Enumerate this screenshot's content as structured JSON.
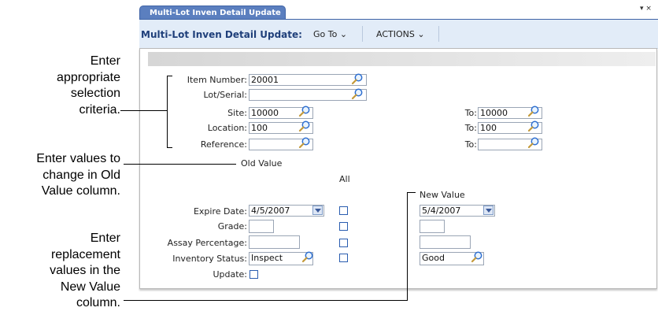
{
  "tab": {
    "title": "Multi-Lot Inven Detail Update",
    "menu": "▾ ×"
  },
  "toolbar": {
    "title": "Multi-Lot Inven Detail Update:",
    "goto": "Go To ⌄",
    "actions": "ACTIONS ⌄"
  },
  "callouts": {
    "selection": [
      "Enter",
      "appropriate",
      "selection",
      "criteria."
    ],
    "old_value": [
      "Enter values to",
      "change in Old",
      "Value column."
    ],
    "replacement": [
      "Enter",
      "replacement",
      "values in the",
      "New Value",
      "column."
    ]
  },
  "form": {
    "item_number": {
      "label": "Item Number:",
      "value": "20001"
    },
    "lot_serial": {
      "label": "Lot/Serial:",
      "value": ""
    },
    "site": {
      "label": "Site:",
      "value": "10000",
      "to_label": "To:",
      "to_value": "10000"
    },
    "location": {
      "label": "Location:",
      "value": "100",
      "to_label": "To:",
      "to_value": "100"
    },
    "reference": {
      "label": "Reference:",
      "value": "",
      "to_label": "To:",
      "to_value": ""
    },
    "old_value_header": "Old Value",
    "all_header": "All",
    "new_value_header": "New Value",
    "expire_date": {
      "label": "Expire Date:",
      "old": "4/5/2007",
      "new": "5/4/2007"
    },
    "grade": {
      "label": "Grade:",
      "old": "",
      "new": ""
    },
    "assay": {
      "label": "Assay Percentage:",
      "old": "",
      "new": ""
    },
    "inventory_status": {
      "label": "Inventory Status:",
      "old": "Inspect",
      "new": "Good"
    },
    "update": {
      "label": "Update:",
      "checked": false
    }
  }
}
